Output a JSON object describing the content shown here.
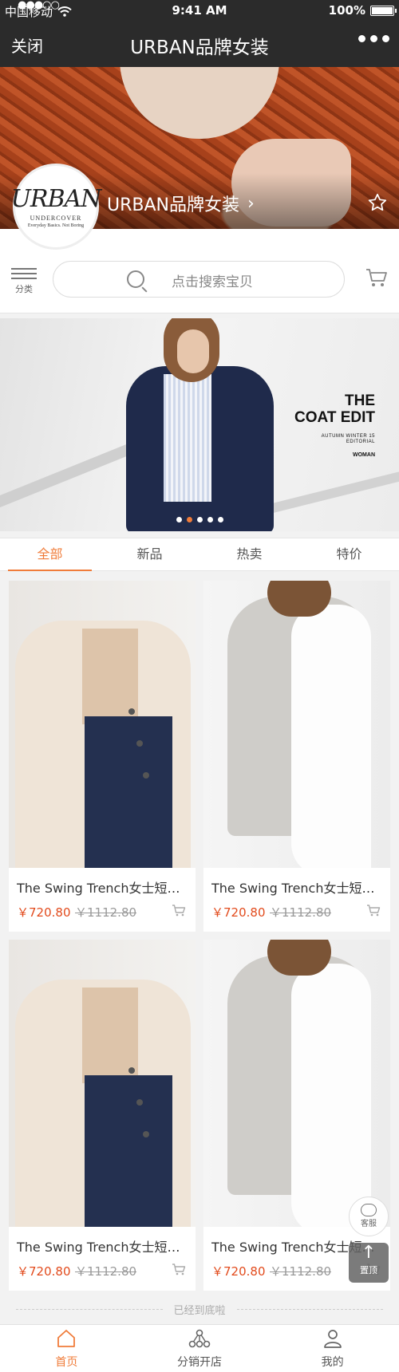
{
  "status": {
    "carrier": "中国移动",
    "time": "9:41 AM",
    "battery": "100%",
    "signal_icon": "signal-dots-icon",
    "wifi_icon": "wifi-icon"
  },
  "nav": {
    "close_label": "关闭",
    "title": "URBAN品牌女装",
    "more_icon": "more-dots-icon"
  },
  "shop": {
    "logo_text": "URBAN",
    "logo_sub": "UNDERCOVER",
    "logo_tagline": "Everyday Basics. Not Boring",
    "name": "URBAN品牌女装",
    "chevron_icon": "chevron-right-icon",
    "favorite_icon": "star-outline-icon"
  },
  "search": {
    "category_label": "分类",
    "placeholder": "点击搜索宝贝",
    "search_icon": "search-icon",
    "cart_icon": "cart-icon"
  },
  "banner": {
    "title_line1": "THE",
    "title_line2": "COAT EDIT",
    "subtitle_line1": "AUTUMN WINTER 15",
    "subtitle_line2": "EDITORIAL",
    "tag": "WOMAN",
    "active_dot": 2,
    "dot_count": 5
  },
  "tabs": [
    {
      "label": "全部",
      "active": true
    },
    {
      "label": "新品",
      "active": false
    },
    {
      "label": "热卖",
      "active": false
    },
    {
      "label": "特价",
      "active": false
    }
  ],
  "products": [
    {
      "name": "The Swing Trench女士短款风衣",
      "price": "￥720.80",
      "old_price": "￥1112.80",
      "style": "a"
    },
    {
      "name": "The Swing Trench女士短款风衣",
      "price": "￥720.80",
      "old_price": "￥1112.80",
      "style": "b"
    },
    {
      "name": "The Swing Trench女士短款风衣",
      "price": "￥720.80",
      "old_price": "￥1112.80",
      "style": "a"
    },
    {
      "name": "The Swing Trench女士短款风衣",
      "price": "￥720.80",
      "old_price": "￥1112.80",
      "style": "b"
    }
  ],
  "floating": {
    "service_label": "客服",
    "top_label": "置顶"
  },
  "end_text": "已经到底啦",
  "tabbar": [
    {
      "label": "首页",
      "icon": "home-icon",
      "active": true
    },
    {
      "label": "分销开店",
      "icon": "distribution-icon",
      "active": false
    },
    {
      "label": "我的",
      "icon": "user-icon",
      "active": false
    }
  ],
  "colors": {
    "accent": "#f07c3a",
    "price": "#e24b1d",
    "navbar": "#2b2b2b"
  }
}
